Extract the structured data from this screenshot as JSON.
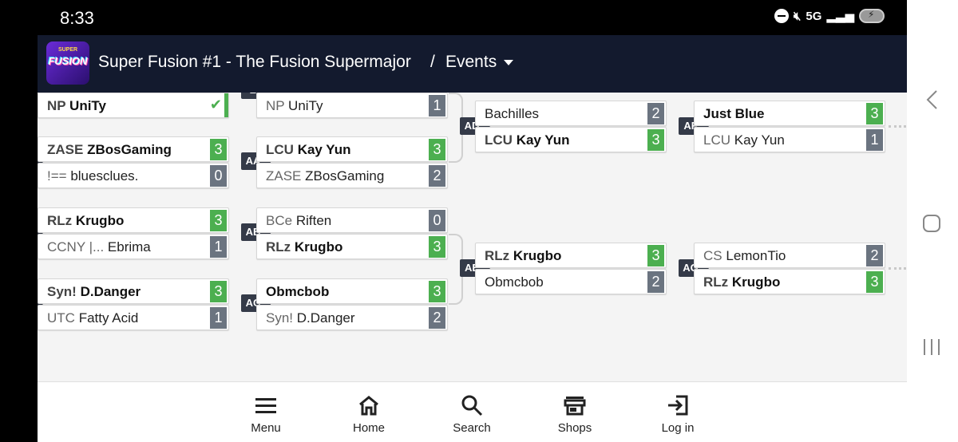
{
  "status": {
    "time": "8:33",
    "network": "5G"
  },
  "header": {
    "logo_top": "SUPER",
    "logo_main": "FUSION",
    "title": "Super Fusion #1 - The Fusion Supermajor",
    "separator": "/",
    "section": "Events"
  },
  "bracket": {
    "col1": [
      {
        "p1": {
          "prefix": "NP",
          "name": "UniTy",
          "score": "",
          "winner": true,
          "check": true
        }
      },
      {
        "p1": {
          "prefix": "ZASE",
          "name": "ZBosGaming",
          "score": "3",
          "winner": true
        },
        "p2": {
          "prefix": "!==",
          "name": "bluesclues.",
          "score": "0",
          "winner": false
        }
      },
      {
        "p1": {
          "prefix": "RLz",
          "name": "Krugbo",
          "score": "3",
          "winner": true
        },
        "p2": {
          "prefix": "CCNY |...",
          "name": "Ebrima",
          "score": "1",
          "winner": false
        }
      },
      {
        "p1": {
          "prefix": "Syn!",
          "name": "D.Danger",
          "score": "3",
          "winner": true
        },
        "p2": {
          "prefix": "UTC",
          "name": "Fatty Acid",
          "score": "1",
          "winner": false
        }
      }
    ],
    "col2": [
      {
        "tag": "Z",
        "p2": {
          "prefix": "NP",
          "name": "UniTy",
          "score": "1",
          "winner": false
        }
      },
      {
        "tag": "AA",
        "p1": {
          "prefix": "LCU",
          "name": "Kay Yun",
          "score": "3",
          "winner": true
        },
        "p2": {
          "prefix": "ZASE",
          "name": "ZBosGaming",
          "score": "2",
          "winner": false
        }
      },
      {
        "tag": "AB",
        "p1": {
          "prefix": "BCe",
          "name": "Riften",
          "score": "0",
          "winner": false
        },
        "p2": {
          "prefix": "RLz",
          "name": "Krugbo",
          "score": "3",
          "winner": true
        }
      },
      {
        "tag": "AC",
        "p1": {
          "prefix": "",
          "name": "Obmcbob",
          "score": "3",
          "winner": true
        },
        "p2": {
          "prefix": "Syn!",
          "name": "D.Danger",
          "score": "2",
          "winner": false
        }
      }
    ],
    "col3": [
      {
        "tag": "AD",
        "p1": {
          "prefix": "",
          "name": "Bachilles",
          "score": "2",
          "winner": false
        },
        "p2": {
          "prefix": "LCU",
          "name": "Kay Yun",
          "score": "3",
          "winner": true
        }
      },
      {
        "tag": "AE",
        "p1": {
          "prefix": "RLz",
          "name": "Krugbo",
          "score": "3",
          "winner": true
        },
        "p2": {
          "prefix": "",
          "name": "Obmcbob",
          "score": "2",
          "winner": false
        }
      }
    ],
    "col4": [
      {
        "tag": "AF",
        "p1": {
          "prefix": "",
          "name": "Just Blue",
          "score": "3",
          "winner": true
        },
        "p2": {
          "prefix": "LCU",
          "name": "Kay Yun",
          "score": "1",
          "winner": false
        }
      },
      {
        "tag": "AG",
        "p1": {
          "prefix": "CS",
          "name": "LemonTio",
          "score": "2",
          "winner": false
        },
        "p2": {
          "prefix": "RLz",
          "name": "Krugbo",
          "score": "3",
          "winner": true
        }
      }
    ]
  },
  "bottom_nav": [
    {
      "label": "Menu",
      "icon": "menu-icon"
    },
    {
      "label": "Home",
      "icon": "home-icon"
    },
    {
      "label": "Search",
      "icon": "search-icon"
    },
    {
      "label": "Shops",
      "icon": "shop-icon"
    },
    {
      "label": "Log in",
      "icon": "login-icon"
    }
  ],
  "colors": {
    "header_bg": "#131a2e",
    "win_score": "#4caf50",
    "loss_score": "#6b7480",
    "tag_bg": "#343a48"
  }
}
